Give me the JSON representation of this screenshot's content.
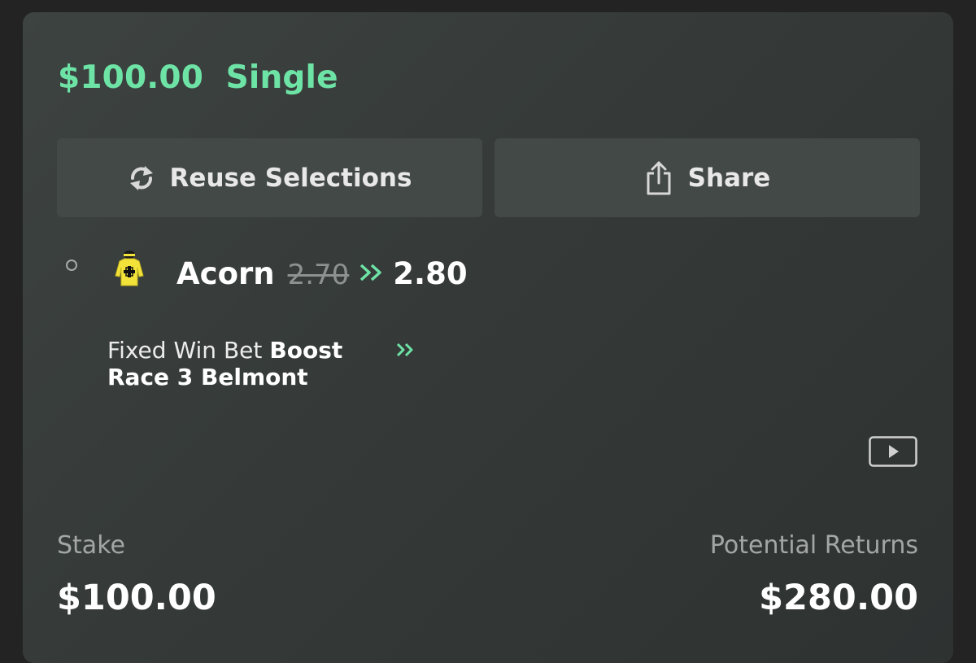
{
  "bet": {
    "amount": "$100.00",
    "type": "Single"
  },
  "actions": {
    "reuse_label": "Reuse Selections",
    "share_label": "Share"
  },
  "selection": {
    "runner": "Acorn",
    "old_odds": "2.70",
    "new_odds": "2.80",
    "market_prefix": "Fixed Win Bet",
    "market_boost": "Boost",
    "event": "Race 3 Belmont",
    "silk_icon": "jockey-silk-yellow-black-cross"
  },
  "summary": {
    "stake_label": "Stake",
    "stake_value": "$100.00",
    "returns_label": "Potential Returns",
    "returns_value": "$280.00"
  },
  "colors": {
    "accent": "#6ee3a6",
    "card": "#3a3f3d",
    "button": "#434947",
    "page_bg": "#232323"
  }
}
